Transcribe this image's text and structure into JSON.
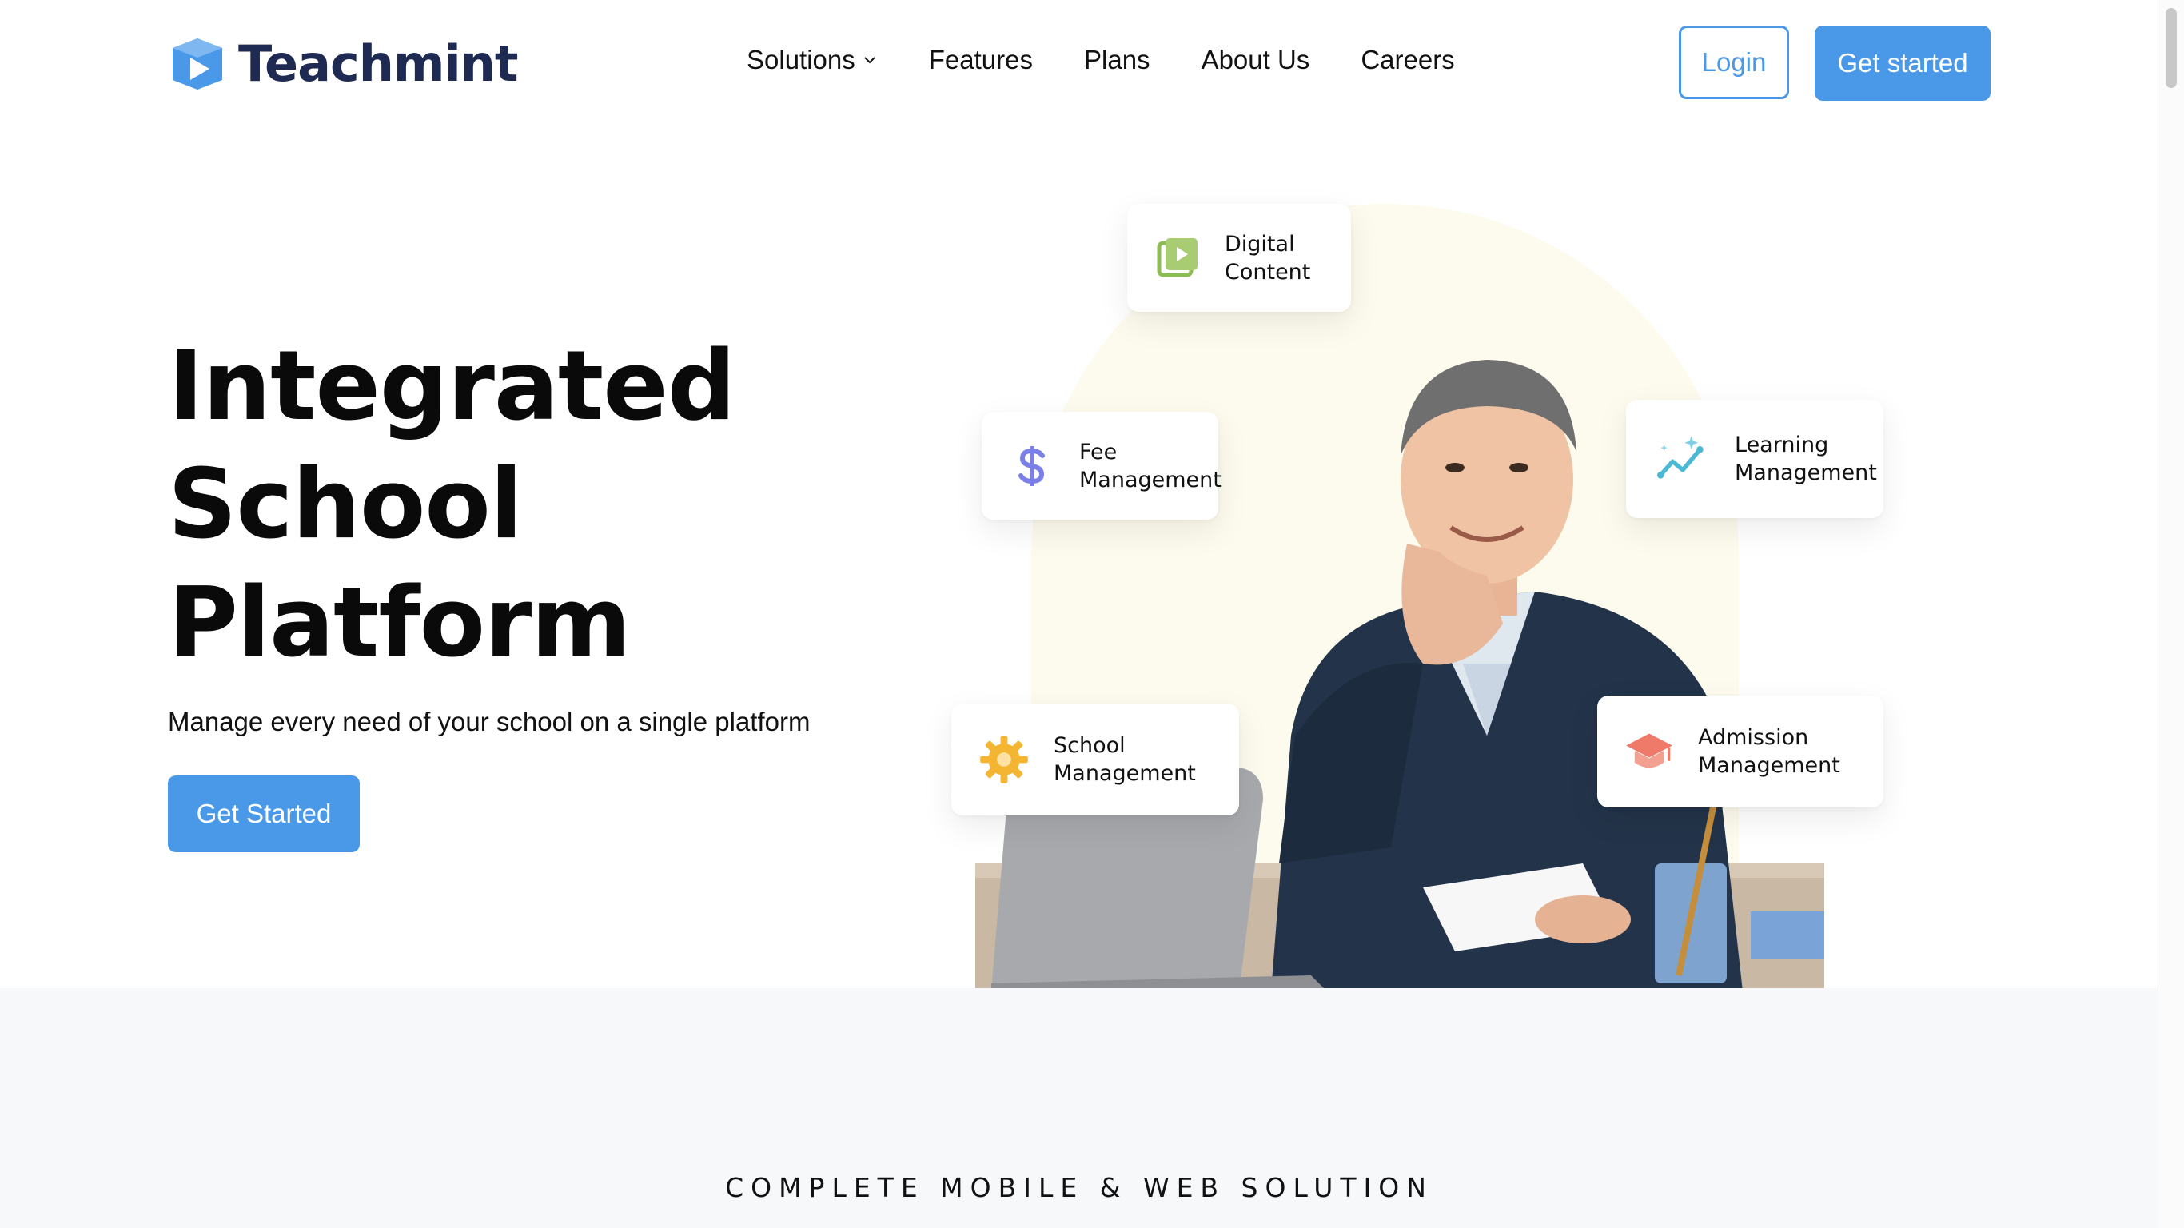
{
  "brand": {
    "name": "Teachmint",
    "color": "#4a99e9",
    "dark": "#1f2a52"
  },
  "nav": {
    "items": [
      {
        "label": "Solutions",
        "has_dropdown": true
      },
      {
        "label": "Features"
      },
      {
        "label": "Plans"
      },
      {
        "label": "About Us"
      },
      {
        "label": "Careers"
      }
    ],
    "login_label": "Login",
    "get_started_label": "Get started"
  },
  "hero": {
    "title_lines": [
      "Integrated",
      "School",
      "Platform"
    ],
    "subtitle": "Manage every need of your school on a single platform",
    "cta_label": "Get Started"
  },
  "feature_cards": [
    {
      "id": "digital",
      "line1": "Digital",
      "line2": "Content",
      "icon": "play-video-icon",
      "icon_color": "#8dbb55"
    },
    {
      "id": "fee",
      "line1": "Fee",
      "line2": "Management",
      "icon": "dollar-icon",
      "icon_color": "#7b7fe8"
    },
    {
      "id": "learning",
      "line1": "Learning",
      "line2": "Management",
      "icon": "trend-sparkle-icon",
      "icon_color": "#4bb9d6"
    },
    {
      "id": "school",
      "line1": "School",
      "line2": "Management",
      "icon": "gear-icon",
      "icon_color": "#f4b632"
    },
    {
      "id": "admission",
      "line1": "Admission",
      "line2": "Management",
      "icon": "graduation-cap-icon",
      "icon_color": "#ef7a6a"
    }
  ],
  "section": {
    "title": "COMPLETE MOBILE & WEB SOLUTION"
  }
}
